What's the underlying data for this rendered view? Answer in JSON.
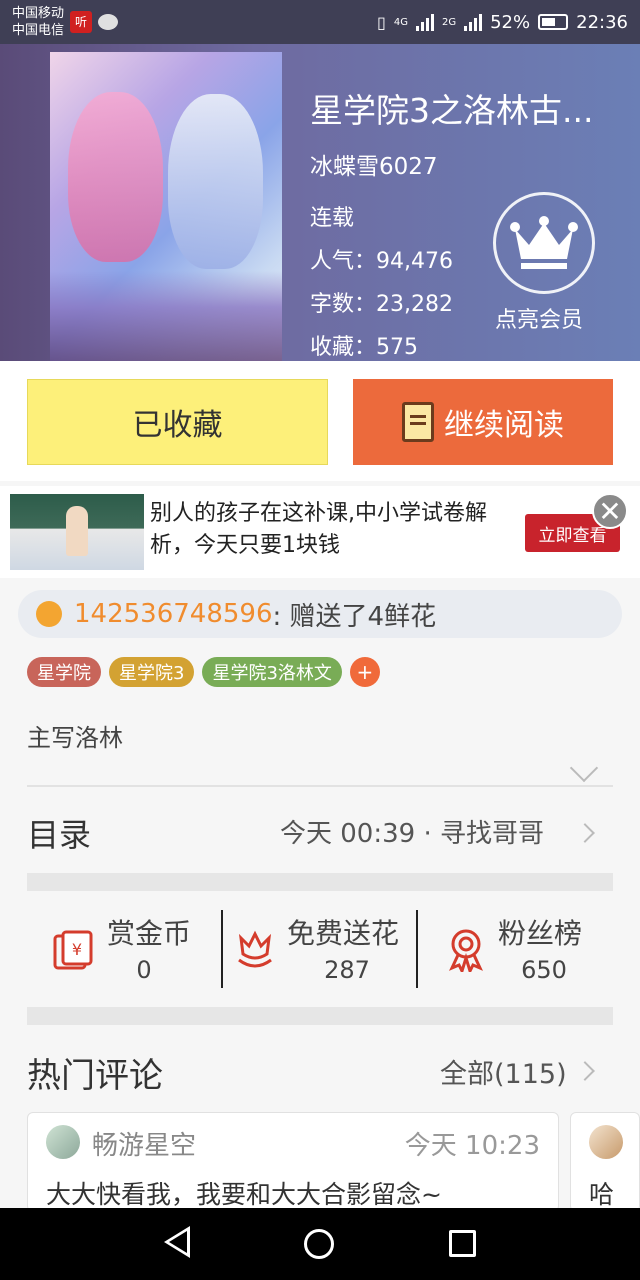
{
  "status_bar": {
    "carrier1": "中国移动",
    "carrier2": "中国电信",
    "app_badge": "听",
    "network1": "4G",
    "network2": "2G",
    "battery": "52%",
    "time": "22:36"
  },
  "book": {
    "title": "星学院3之洛林古...",
    "author": "冰蝶雪6027",
    "status": "连载",
    "popularity": "人气：94,476",
    "word_count": "字数：23,282",
    "favorites": "收藏：575",
    "vip_label": "点亮会员"
  },
  "actions": {
    "collected_label": "已收藏",
    "read_label": "继续阅读"
  },
  "ad": {
    "text": "别人的孩子在这补课,中小学试卷解析，今天只要1块钱",
    "cta": "立即查看",
    "close": "✕"
  },
  "gift": {
    "user": "142536748596",
    "message": ": 赠送了4鲜花"
  },
  "tags": [
    {
      "label": "星学院",
      "color": "#c8655a"
    },
    {
      "label": "星学院3",
      "color": "#d3a232"
    },
    {
      "label": "星学院3洛林文",
      "color": "#79ac56"
    }
  ],
  "tag_add": "+",
  "description": "主写洛林",
  "toc": {
    "title": "目录",
    "latest": "今天 00:39 · 寻找哥哥"
  },
  "stats": [
    {
      "label": "赏金币",
      "value": "0",
      "icon": "money-envelope-icon"
    },
    {
      "label": "免费送花",
      "value": "287",
      "icon": "flower-icon"
    },
    {
      "label": "粉丝榜",
      "value": "650",
      "icon": "ribbon-badge-icon"
    }
  ],
  "comments": {
    "title": "热门评论",
    "all_label": "全部(115)",
    "items": [
      {
        "user": "畅游星空",
        "time": "今天 10:23",
        "text": "大大快看我，我要和大大合影留念~"
      },
      {
        "text": "哈"
      }
    ]
  },
  "colors": {
    "accent_orange": "#ec6a3c",
    "collected_yellow": "#fdf07a",
    "gift_user": "#f08c2e"
  }
}
